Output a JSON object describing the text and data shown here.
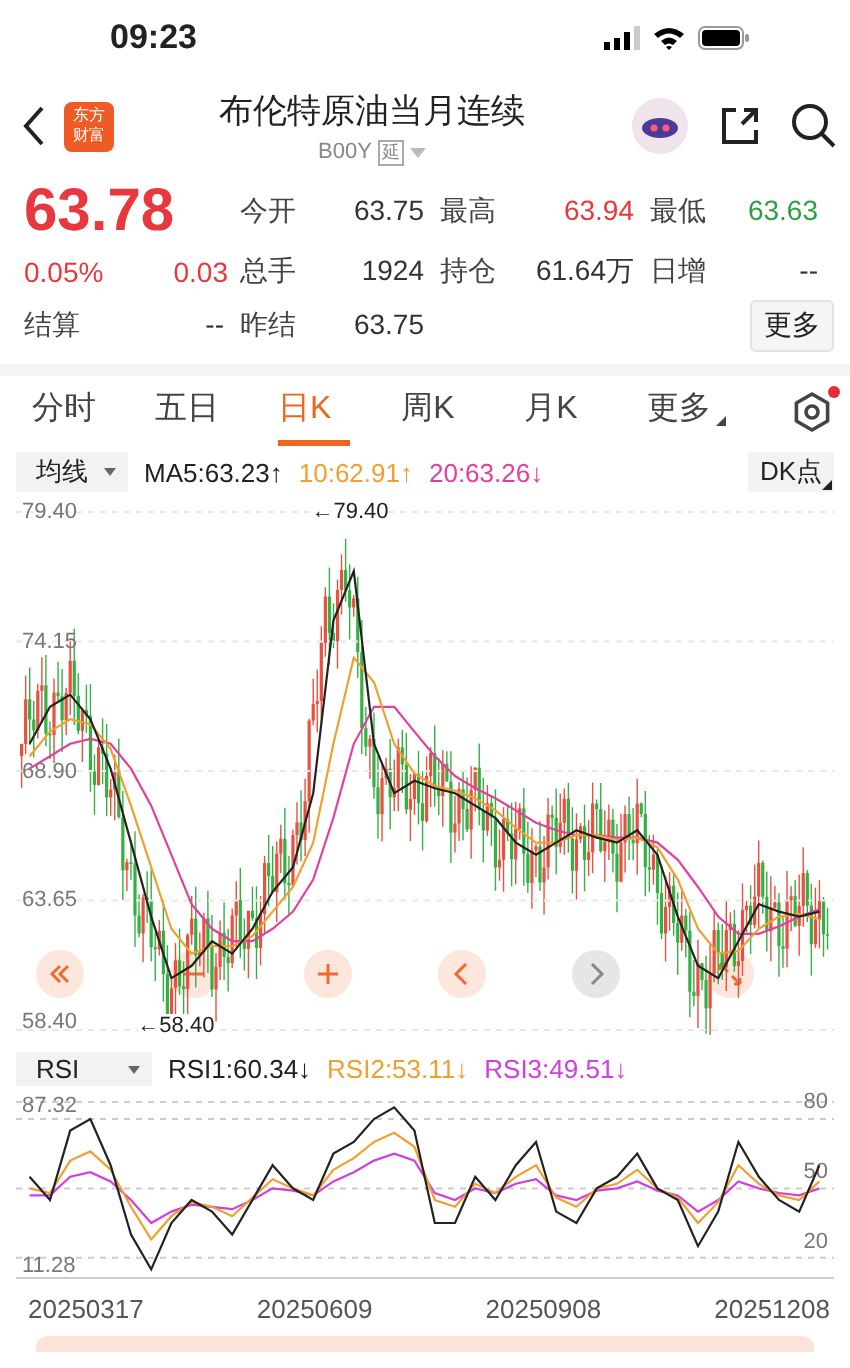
{
  "status_bar": {
    "time": "09:23"
  },
  "header": {
    "logo": [
      "东方",
      "财富"
    ],
    "title": "布伦特原油当月连续",
    "code": "B00Y",
    "tag": "延"
  },
  "quote": {
    "price": "63.78",
    "color": "#e8383d",
    "change_pct": "0.05%",
    "change": "0.03",
    "settlement": {
      "label": "结算",
      "value": "--"
    },
    "fields": [
      {
        "label": "今开",
        "value": "63.75",
        "color": "#333333"
      },
      {
        "label": "最高",
        "value": "63.94",
        "color": "#e8383d"
      },
      {
        "label": "最低",
        "value": "63.63",
        "color": "#2ea043"
      },
      {
        "label": "总手",
        "value": "1924",
        "color": "#333333"
      },
      {
        "label": "持仓",
        "value": "61.64万",
        "color": "#333333"
      },
      {
        "label": "日增",
        "value": "--",
        "color": "#333333"
      },
      {
        "label": "昨结",
        "value": "63.75",
        "color": "#333333"
      }
    ],
    "more_button": "更多"
  },
  "tabs": [
    {
      "label": "分时",
      "selected": false,
      "kind": "plain"
    },
    {
      "label": "五日",
      "selected": false,
      "kind": "plain"
    },
    {
      "label": "日K",
      "selected": true,
      "kind": "plain"
    },
    {
      "label": "周K",
      "selected": false,
      "kind": "plain"
    },
    {
      "label": "月K",
      "selected": false,
      "kind": "plain"
    },
    {
      "label": "更多",
      "selected": false,
      "kind": "menu"
    }
  ],
  "settings": {
    "notification_dot": true
  },
  "kline": {
    "indicator": "均线",
    "legend": [
      {
        "text": ":63.23↑"
      },
      {
        "text": ":62.91↑"
      },
      {
        "text": ":63.26↓"
      }
    ],
    "dk_button": "DK点",
    "chart_data": {
      "type": "line",
      "grid": true,
      "ylim": [
        58.4,
        79.4
      ],
      "yticks": [
        {
          "value": 79.4,
          "label": "79.40"
        },
        {
          "value": 74.15,
          "label": "74.15"
        },
        {
          "value": 68.9,
          "label": "68.90"
        },
        {
          "value": 63.65,
          "label": "63.65"
        },
        {
          "value": 58.4,
          "label": "58.40"
        }
      ],
      "series": [
        {
          "name": "MA5",
          "color": "#222222",
          "values": [
            70,
            71.5,
            72,
            71,
            69,
            66,
            63,
            60.5,
            61,
            62,
            61.5,
            62.5,
            64,
            65,
            68,
            75,
            77,
            70,
            68,
            68.5,
            68.2,
            68,
            67.5,
            67,
            66,
            65.5,
            66,
            66.5,
            66.2,
            66,
            66.5,
            65.5,
            63,
            61,
            60.5,
            62,
            63.5,
            63.2,
            63,
            63.2
          ]
        },
        {
          "name": "10",
          "color": "#f0a030",
          "values": [
            69.5,
            70.5,
            71,
            70.8,
            69.8,
            67.5,
            65,
            62.5,
            61.5,
            61.8,
            61.8,
            62.2,
            63.2,
            64.2,
            66,
            70,
            73.5,
            72.5,
            70,
            68.8,
            68.3,
            68.1,
            67.8,
            67.3,
            66.6,
            66,
            66,
            66.3,
            66.3,
            66.1,
            66.2,
            65.8,
            64.5,
            62.5,
            61.5,
            61.6,
            62.5,
            63,
            63.1,
            62.9
          ]
        },
        {
          "name": "20",
          "color": "#e040a0",
          "values": [
            69,
            69.5,
            70,
            70.2,
            70,
            69,
            67.5,
            65.5,
            63.5,
            62.5,
            62,
            62,
            62.5,
            63.2,
            64.5,
            67,
            70,
            71.5,
            71.5,
            70.5,
            69.5,
            68.7,
            68.2,
            67.8,
            67.3,
            66.8,
            66.5,
            66.3,
            66.3,
            66.2,
            66.2,
            66,
            65.3,
            64.2,
            63,
            62.3,
            62.3,
            62.6,
            63,
            63.3
          ]
        }
      ]
    },
    "high_marker": "←79.40",
    "low_marker": "←58.40",
    "controls": [
      {
        "kind": "rewind",
        "disabled": false
      },
      {
        "kind": "zoom-out",
        "disabled": false
      },
      {
        "kind": "zoom-in",
        "disabled": false
      },
      {
        "kind": "previous",
        "disabled": false
      },
      {
        "kind": "next",
        "disabled": true
      },
      {
        "kind": "expand",
        "disabled": false
      }
    ]
  },
  "rsi": {
    "indicator": "RSI",
    "legend": [
      {
        "text": ":60.34↓"
      },
      {
        "text": ":53.11↓"
      },
      {
        "text": ":49.51↓"
      }
    ],
    "left_labels": [
      "87.32",
      "11.28"
    ],
    "chart_data": {
      "type": "line",
      "grid": true,
      "ylim": [
        11.28,
        87.32
      ],
      "yticks": [
        {
          "value": 80,
          "label": "80"
        },
        {
          "value": 50,
          "label": "50"
        },
        {
          "value": 20,
          "label": "20"
        }
      ],
      "series": [
        {
          "name": "RSI1",
          "color": "#222222",
          "values": [
            55,
            45,
            75,
            80,
            60,
            30,
            15,
            35,
            45,
            40,
            30,
            45,
            60,
            50,
            45,
            65,
            70,
            80,
            85,
            75,
            35,
            35,
            55,
            45,
            60,
            70,
            40,
            35,
            50,
            55,
            65,
            50,
            45,
            25,
            40,
            70,
            55,
            45,
            40,
            60
          ]
        },
        {
          "name": "RSI2",
          "color": "#f0a030",
          "values": [
            50,
            48,
            62,
            66,
            58,
            42,
            28,
            38,
            44,
            42,
            38,
            46,
            54,
            50,
            47,
            58,
            63,
            70,
            74,
            68,
            45,
            42,
            52,
            48,
            55,
            60,
            46,
            42,
            50,
            52,
            58,
            50,
            46,
            35,
            44,
            60,
            52,
            47,
            45,
            53
          ]
        },
        {
          "name": "RSI3",
          "color": "#d040e0",
          "values": [
            47,
            47,
            55,
            57,
            53,
            45,
            35,
            40,
            43,
            42,
            41,
            45,
            50,
            49,
            47,
            53,
            57,
            62,
            65,
            62,
            48,
            45,
            50,
            48,
            52,
            54,
            47,
            45,
            49,
            50,
            53,
            49,
            47,
            40,
            45,
            53,
            50,
            48,
            47,
            50
          ]
        }
      ]
    }
  },
  "dates": [
    "20250317",
    "20250609",
    "20250908",
    "20251208"
  ]
}
